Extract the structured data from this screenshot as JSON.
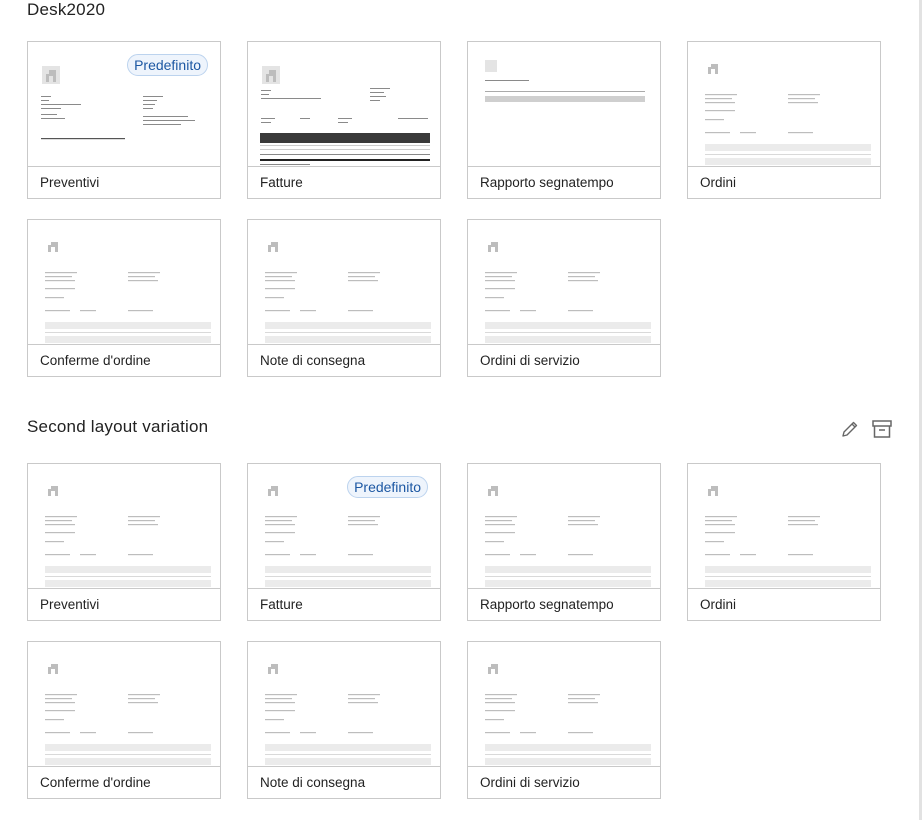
{
  "sections": [
    {
      "title": "Desk2020",
      "cards": [
        {
          "label": "Preventivi",
          "default": true,
          "badge": "Predefinito"
        },
        {
          "label": "Fatture",
          "default": false
        },
        {
          "label": "Rapporto segnatempo",
          "default": false
        },
        {
          "label": "Ordini",
          "default": false
        },
        {
          "label": "Conferme d'ordine",
          "default": false
        },
        {
          "label": "Note di consegna",
          "default": false
        },
        {
          "label": "Ordini di servizio",
          "default": false
        }
      ]
    },
    {
      "title": "Second layout variation",
      "actions": [
        {
          "name": "edit-layout-button",
          "icon": "pencil-icon"
        },
        {
          "name": "archive-layout-button",
          "icon": "archive-icon"
        }
      ],
      "cards": [
        {
          "label": "Preventivi",
          "default": false
        },
        {
          "label": "Fatture",
          "default": true,
          "badge": "Predefinito"
        },
        {
          "label": "Rapporto segnatempo",
          "default": false
        },
        {
          "label": "Ordini",
          "default": false
        },
        {
          "label": "Conferme d'ordine",
          "default": false
        },
        {
          "label": "Note di consegna",
          "default": false
        },
        {
          "label": "Ordini di servizio",
          "default": false
        }
      ]
    }
  ],
  "colors": {
    "badge_text": "#1d58a3",
    "badge_bg": "#eef4fc",
    "border": "#c9c9c9"
  }
}
